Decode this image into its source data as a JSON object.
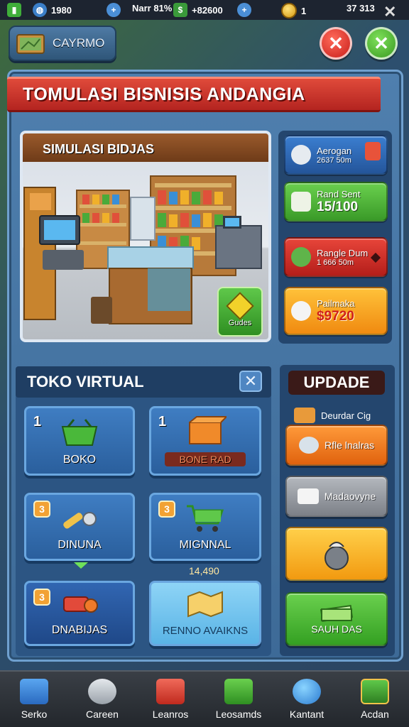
{
  "topbar": {
    "stat1": "1980",
    "stat2": "Narr 81%",
    "stat3": "+82600",
    "coins": "1",
    "count": "37 313",
    "close_glyph": "✕",
    "icons": [
      "app-icon",
      "globe-icon",
      "plus-icon",
      "cash-icon",
      "plus-icon",
      "coin-icon",
      "close-icon"
    ]
  },
  "header": {
    "back_label": "CAYRMO",
    "cancel_glyph": "✕",
    "confirm_glyph": "✕"
  },
  "title": "TOMULASI BISNISIS ANDANGIA",
  "scene": {
    "store_sign": "SIMULASI BIDJAS",
    "guides_label": "Gudes"
  },
  "side_cards": [
    {
      "line1": "Aerogan",
      "line2": "2637 50m",
      "color": "#2a5fa8"
    },
    {
      "line1": "Rand Sent",
      "line2": "15/100",
      "color": "#4aa838"
    },
    {
      "line1": "Rangle Dum",
      "line2": "1 666 50m",
      "color": "#d02a24"
    },
    {
      "line1": "Pailmaka",
      "line2": "$9720",
      "color": "#f0a218"
    }
  ],
  "toko": {
    "title": "TOKO VIRTUAL",
    "close_glyph": "✕",
    "tiles": [
      {
        "num": "1",
        "label": "BOKO"
      },
      {
        "num": "1",
        "label": "BONE RAD"
      },
      {
        "num": "3",
        "label": "DINUNA"
      },
      {
        "num": "3",
        "label": "MIGNNAL"
      },
      {
        "num": "3",
        "label": "DNABIJAS"
      },
      {
        "num": "",
        "label": "RENNO AVAIKNS"
      }
    ],
    "price_note": "14,490"
  },
  "update": {
    "title": "UPDADE",
    "note": "Deurdar Cig",
    "buttons": [
      {
        "label": "Rfle lnalras",
        "color": "#f07a1c"
      },
      {
        "label": "Madaovyne",
        "color": "#8e9298"
      },
      {
        "label": "",
        "color": "#f6b21e"
      },
      {
        "label": "SAUH DAS",
        "color": "#4ab43a"
      }
    ]
  },
  "nav": [
    {
      "label": "Serko",
      "icon": "basket-icon"
    },
    {
      "label": "Careen",
      "icon": "key-icon"
    },
    {
      "label": "Leanros",
      "icon": "basket-icon"
    },
    {
      "label": "Leosamds",
      "icon": "bag-icon"
    },
    {
      "label": "Kantant",
      "icon": "globe-icon"
    },
    {
      "label": "Acdan",
      "icon": "treasure-icon"
    }
  ]
}
